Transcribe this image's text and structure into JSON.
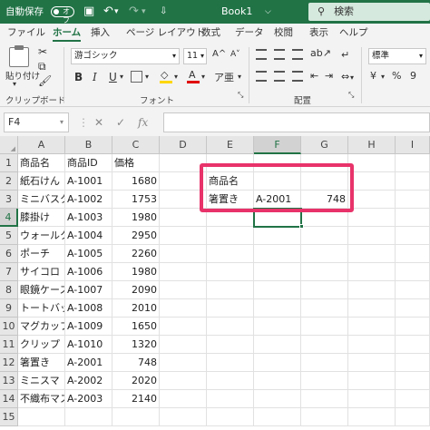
{
  "titlebar": {
    "autosave_label": "自動保存",
    "autosave_state": "オフ",
    "document_title": "Book1",
    "search_placeholder": "検索"
  },
  "menu": [
    "ファイル",
    "ホーム",
    "挿入",
    "ページ レイアウト",
    "数式",
    "データ",
    "校閲",
    "表示",
    "ヘルプ"
  ],
  "menu_active": "ホーム",
  "ribbon": {
    "paste_label": "貼り付け",
    "clipboard_group": "クリップボード",
    "font_name": "游ゴシック",
    "font_size": "11",
    "font_group": "フォント",
    "alignment_group": "配置",
    "number_format": "標準",
    "bold": "B",
    "italic": "I",
    "underline": "U",
    "font_color_glyph": "A",
    "grow_font": "A^",
    "shrink_font": "A˅"
  },
  "formula_bar": {
    "name_box": "F4",
    "fx_label": "fx",
    "cancel": "✕",
    "confirm": "✓",
    "value": ""
  },
  "columns": [
    "A",
    "B",
    "C",
    "D",
    "E",
    "F",
    "G",
    "H",
    "I"
  ],
  "rows": [
    "1",
    "2",
    "3",
    "4",
    "5",
    "6",
    "7",
    "8",
    "9",
    "10",
    "11",
    "12",
    "13",
    "14",
    "15"
  ],
  "sheet": {
    "A": [
      "商品名",
      "紙石けん",
      "ミニバスク",
      "膝掛け",
      "ウォールク",
      "ポーチ",
      "サイコロ",
      "眼鏡ケース",
      "トートバッ",
      "マグカップ",
      "クリップ",
      "箸置き",
      "ミニスマ",
      "不織布マス",
      ""
    ],
    "B": [
      "商品ID",
      "A-1001",
      "A-1002",
      "A-1003",
      "A-1004",
      "A-1005",
      "A-1006",
      "A-1007",
      "A-1008",
      "A-1009",
      "A-1010",
      "A-2001",
      "A-2002",
      "A-2003",
      ""
    ],
    "C": [
      "価格",
      "1680",
      "1753",
      "1980",
      "2950",
      "2260",
      "1980",
      "2090",
      "2010",
      "1650",
      "1320",
      "748",
      "2020",
      "2140",
      ""
    ]
  },
  "lookup": {
    "e2": "商品名",
    "e3": "箸置き",
    "f3": "A-2001",
    "g3": "748"
  },
  "active_cell": "F4",
  "colors": {
    "excel_green": "#217346",
    "highlight": "#e8336a"
  }
}
